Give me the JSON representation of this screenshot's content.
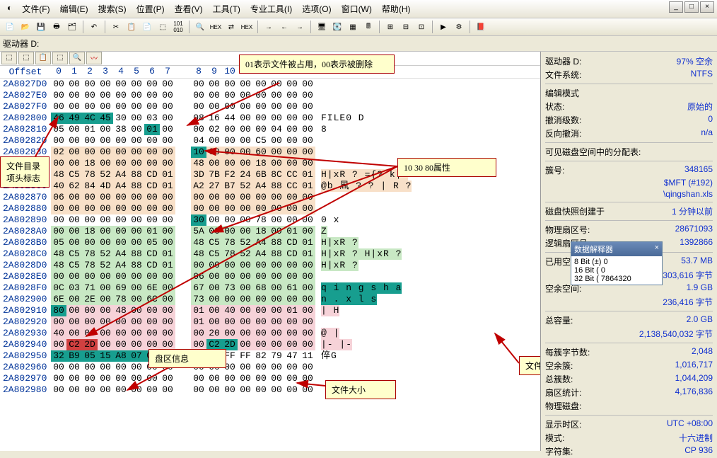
{
  "menus": [
    "文件(F)",
    "编辑(E)",
    "搜索(S)",
    "位置(P)",
    "查看(V)",
    "工具(T)",
    "专业工具(I)",
    "选项(O)",
    "窗口(W)",
    "帮助(H)"
  ],
  "drivebar": "驱动器 D:",
  "hex": {
    "header_label": "Offset",
    "cols": [
      "0",
      "1",
      "2",
      "3",
      "4",
      "5",
      "6",
      "7",
      "8",
      "9",
      "10",
      "11",
      "12",
      "13",
      "14",
      "15"
    ],
    "rows": [
      {
        "off": "2A8027D0",
        "b": [
          "00",
          "00",
          "00",
          "00",
          "00",
          "00",
          "00",
          "00",
          "00",
          "00",
          "00",
          "00",
          "00",
          "00",
          "00",
          "00"
        ],
        "asc": ""
      },
      {
        "off": "2A8027E0",
        "b": [
          "00",
          "00",
          "00",
          "00",
          "00",
          "00",
          "00",
          "00",
          "00",
          "00",
          "00",
          "00",
          "00",
          "00",
          "00",
          "00"
        ],
        "asc": ""
      },
      {
        "off": "2A8027F0",
        "b": [
          "00",
          "00",
          "00",
          "00",
          "00",
          "00",
          "00",
          "00",
          "00",
          "00",
          "00",
          "00",
          "00",
          "00",
          "00",
          "00"
        ],
        "asc": ""
      },
      {
        "off": "2A802800",
        "b": [
          "46",
          "49",
          "4C",
          "45",
          "30",
          "00",
          "03",
          "00",
          "08",
          "16",
          "44",
          "00",
          "00",
          "00",
          "00",
          "00"
        ],
        "asc": "FILE0     D",
        "hl": [
          0,
          1,
          2,
          3
        ]
      },
      {
        "off": "2A802810",
        "b": [
          "05",
          "00",
          "01",
          "00",
          "38",
          "00",
          "01",
          "00",
          "00",
          "02",
          "00",
          "00",
          "00",
          "04",
          "00",
          "00"
        ],
        "asc": "    8",
        "hl6": true
      },
      {
        "off": "2A802820",
        "b": [
          "00",
          "00",
          "00",
          "00",
          "00",
          "00",
          "00",
          "00",
          "04",
          "00",
          "00",
          "00",
          "C5",
          "00",
          "00",
          "00"
        ],
        "asc": ""
      },
      {
        "off": "2A802830",
        "b": [
          "02",
          "00",
          "00",
          "00",
          "00",
          "00",
          "00",
          "00",
          "10",
          "00",
          "00",
          "00",
          "60",
          "00",
          "00",
          "00"
        ],
        "asc": "",
        "hl8": true,
        "peach": true
      },
      {
        "off": "2A802840",
        "b": [
          "00",
          "00",
          "18",
          "00",
          "00",
          "00",
          "00",
          "00",
          "48",
          "00",
          "00",
          "00",
          "18",
          "00",
          "00",
          "00"
        ],
        "asc": "",
        "peach": true
      },
      {
        "off": "2A802850",
        "b": [
          "48",
          "C5",
          "78",
          "52",
          "A4",
          "88",
          "CD",
          "01",
          "3D",
          "7B",
          "F2",
          "24",
          "6B",
          "8C",
          "CC",
          "01"
        ],
        "asc": "H|xR  ?  ={? k|?",
        "peach": true
      },
      {
        "off": "2A802860",
        "b": [
          "40",
          "62",
          "84",
          "4D",
          "A4",
          "88",
          "CD",
          "01",
          "A2",
          "27",
          "B7",
          "52",
          "A4",
          "88",
          "CC",
          "01"
        ],
        "asc": "@b 凮  ?  ? | R ?",
        "peach": true
      },
      {
        "off": "2A802870",
        "b": [
          "06",
          "00",
          "00",
          "00",
          "00",
          "00",
          "00",
          "00",
          "00",
          "00",
          "00",
          "00",
          "00",
          "00",
          "00",
          "00"
        ],
        "asc": "",
        "peach": true
      },
      {
        "off": "2A802880",
        "b": [
          "00",
          "00",
          "00",
          "00",
          "00",
          "00",
          "00",
          "00",
          "00",
          "00",
          "00",
          "00",
          "00",
          "00",
          "00",
          "00"
        ],
        "asc": "",
        "peach": true
      },
      {
        "off": "2A802890",
        "b": [
          "00",
          "00",
          "00",
          "00",
          "00",
          "00",
          "00",
          "00",
          "30",
          "00",
          "00",
          "00",
          "78",
          "00",
          "00",
          "00"
        ],
        "asc": "       0   x",
        "hl8g": true
      },
      {
        "off": "2A8028A0",
        "b": [
          "00",
          "00",
          "18",
          "00",
          "00",
          "00",
          "01",
          "00",
          "5A",
          "00",
          "00",
          "00",
          "18",
          "00",
          "01",
          "00"
        ],
        "asc": "        Z",
        "green": true
      },
      {
        "off": "2A8028B0",
        "b": [
          "05",
          "00",
          "00",
          "00",
          "00",
          "00",
          "05",
          "00",
          "48",
          "C5",
          "78",
          "52",
          "A4",
          "88",
          "CD",
          "01"
        ],
        "asc": "        H|xR  ?",
        "green": true
      },
      {
        "off": "2A8028C0",
        "b": [
          "48",
          "C5",
          "78",
          "52",
          "A4",
          "88",
          "CD",
          "01",
          "48",
          "C5",
          "78",
          "52",
          "A4",
          "88",
          "CD",
          "01"
        ],
        "asc": "H|xR  ?  H|xR  ?",
        "green": true
      },
      {
        "off": "2A8028D0",
        "b": [
          "48",
          "C5",
          "78",
          "52",
          "A4",
          "88",
          "CD",
          "01",
          "00",
          "00",
          "00",
          "00",
          "00",
          "00",
          "00",
          "00"
        ],
        "asc": "H|xR  ?",
        "green": true
      },
      {
        "off": "2A8028E0",
        "b": [
          "00",
          "00",
          "00",
          "00",
          "00",
          "00",
          "00",
          "00",
          "06",
          "00",
          "00",
          "00",
          "00",
          "00",
          "00",
          "00"
        ],
        "asc": "",
        "green": true
      },
      {
        "off": "2A8028F0",
        "b": [
          "0C",
          "03",
          "71",
          "00",
          "69",
          "00",
          "6E",
          "00",
          "67",
          "00",
          "73",
          "00",
          "68",
          "00",
          "61",
          "00"
        ],
        "asc": "  q i n g s h a",
        "green": true,
        "asc_teal": true
      },
      {
        "off": "2A802900",
        "b": [
          "6E",
          "00",
          "2E",
          "00",
          "78",
          "00",
          "6C",
          "00",
          "73",
          "00",
          "00",
          "00",
          "00",
          "00",
          "00",
          "00"
        ],
        "asc": "n . x l s",
        "green": true,
        "asc_teal": true
      },
      {
        "off": "2A802910",
        "b": [
          "80",
          "00",
          "00",
          "00",
          "48",
          "00",
          "00",
          "00",
          "01",
          "00",
          "40",
          "00",
          "00",
          "00",
          "01",
          "00"
        ],
        "asc": "|   H",
        "hl0": true,
        "pink": true
      },
      {
        "off": "2A802920",
        "b": [
          "00",
          "00",
          "00",
          "00",
          "00",
          "00",
          "00",
          "00",
          "01",
          "00",
          "00",
          "00",
          "00",
          "00",
          "00",
          "00"
        ],
        "asc": "",
        "pink": true
      },
      {
        "off": "2A802930",
        "b": [
          "40",
          "00",
          "00",
          "00",
          "00",
          "00",
          "00",
          "00",
          "00",
          "20",
          "00",
          "00",
          "00",
          "00",
          "00",
          "00"
        ],
        "asc": "@       |",
        "pink": true
      },
      {
        "off": "2A802940",
        "b": [
          "00",
          "C2",
          "2D",
          "00",
          "00",
          "00",
          "00",
          "00",
          "00",
          "C2",
          "2D",
          "00",
          "00",
          "00",
          "00",
          "00"
        ],
        "asc": "  |-      |-",
        "pink": true,
        "hl_sz": [
          1,
          2
        ],
        "hl_sz2": [
          9,
          10
        ]
      },
      {
        "off": "2A802950",
        "b": [
          "32",
          "B9",
          "05",
          "15",
          "A8",
          "07",
          "00",
          "00",
          "FF",
          "FF",
          "FF",
          "FF",
          "82",
          "79",
          "47",
          "11"
        ],
        "asc": "           倅G",
        "teal_range": [
          0,
          7
        ]
      },
      {
        "off": "2A802960",
        "b": [
          "00",
          "00",
          "00",
          "00",
          "00",
          "00",
          "00",
          "00",
          "00",
          "00",
          "00",
          "00",
          "00",
          "00",
          "00",
          "00"
        ],
        "asc": ""
      },
      {
        "off": "2A802970",
        "b": [
          "00",
          "00",
          "00",
          "00",
          "00",
          "00",
          "00",
          "00",
          "00",
          "00",
          "00",
          "00",
          "00",
          "00",
          "00",
          "00"
        ],
        "asc": ""
      },
      {
        "off": "2A802980",
        "b": [
          "00",
          "00",
          "00",
          "00",
          "00",
          "00",
          "00",
          "00",
          "00",
          "00",
          "00",
          "00",
          "00",
          "00",
          "00",
          "00"
        ],
        "asc": ""
      }
    ]
  },
  "callouts": {
    "c1": "01表示文件被占用，00表示被删除",
    "c2": "文件目录项头标志",
    "c3": "10 30 80属性",
    "c4": "盘区信息",
    "c5": "文件大小",
    "c6": "文件名"
  },
  "sidebar": {
    "drive_l": "驱动器 D:",
    "drive_v": "97% 空余",
    "fs_l": "文件系统:",
    "fs_v": "NTFS",
    "editmode_l": "编辑模式",
    "state_l": "状态:",
    "state_v": "原始的",
    "undo_l": "撤消级数:",
    "undo_v": "0",
    "rundo_l": "反向撤消:",
    "rundo_v": "n/a",
    "alloc_l": "可见磁盘空间中的分配表:",
    "clus_l": "簇号:",
    "clus_v": "348165",
    "mft_v": "$MFT (#192)",
    "file_v": "\\qingshan.xls",
    "snap_l": "磁盘快照创建于",
    "snap_v": "1 分钟以前",
    "psec_l": "物理扇区号:",
    "psec_v": "28671093",
    "lsec_l": "逻辑扇区号:",
    "lsec_v": "1392866",
    "used_l": "已用空间:",
    "used_v": "53.7 MB",
    "used_v2": "303,616 字节",
    "free_l": "空余空间:",
    "free_v": "1.9 GB",
    "free_v2": "236,416 字节",
    "total_l": "总容量:",
    "total_v": "2.0 GB",
    "total_v2": "2,138,540,032 字节",
    "bpc_l": "每簇字节数:",
    "bpc_v": "2,048",
    "frclus_l": "空余簇:",
    "frclus_v": "1,016,717",
    "tclus_l": "总簇数:",
    "tclus_v": "1,044,209",
    "secstat_l": "扇区统计:",
    "secstat_v": "4,176,836",
    "pdisk_l": "物理磁盘:",
    "tz_l": "显示时区:",
    "tz_v": "UTC +08:00",
    "mode_l": "模式:",
    "mode_v": "十六进制",
    "charset_l": "字符集:",
    "charset_v": "CP 936"
  },
  "interpreter": {
    "title": "数据解释器",
    "l1": "8 Bit (±) 0",
    "l2": "16 Bit ( 0",
    "l3": "32 Bit ( 7864320"
  }
}
